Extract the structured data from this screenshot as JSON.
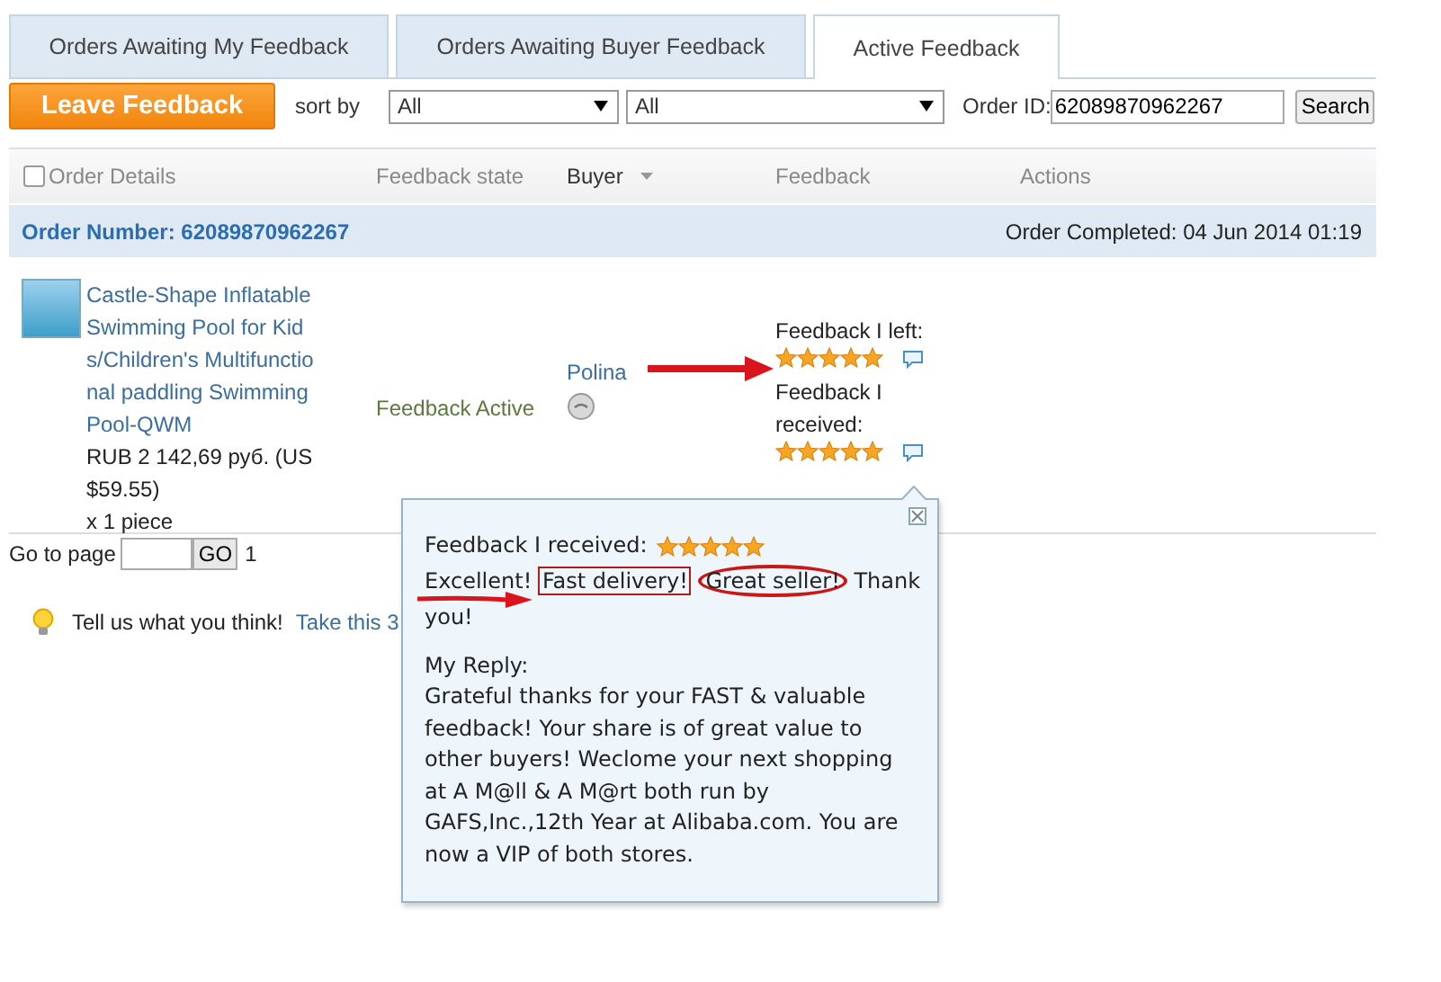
{
  "tabs": [
    {
      "label": "Orders Awaiting My Feedback",
      "selected": false
    },
    {
      "label": "Orders Awaiting Buyer Feedback",
      "selected": false
    },
    {
      "label": "Active Feedback",
      "selected": true
    }
  ],
  "toolbar": {
    "leave_button": "Leave Feedback",
    "sort_label": "sort by",
    "sort_selects": [
      {
        "value": "All"
      },
      {
        "value": "All"
      }
    ],
    "order_id_label": "Order ID:",
    "order_id_value": "62089870962267",
    "search_button": "Search"
  },
  "table": {
    "select_all": {
      "label": "Order Details",
      "checked": false
    },
    "columns": [
      "Feedback state",
      "Buyer",
      "Feedback",
      "Actions"
    ],
    "order": {
      "number": "Order Number: 62089870962267",
      "completed": "Order Completed: 04 Jun 2014 01:19",
      "product_title": "Castle-Shape Inflatable Swimming Pool for Kids/Children's Multifunctional paddling Swimming Pool-QWM",
      "price": "RUB 2 142,69 руб. (US $59.55)",
      "quantity": "x 1 piece",
      "feedback_state": "Feedback Active",
      "buyer": "Polina",
      "feedback": [
        {
          "label": "Feedback I left:",
          "stars": 5
        },
        {
          "label": "Feedback I received:",
          "stars": 5
        }
      ]
    }
  },
  "pager": {
    "label": "Go to page",
    "go_button": "GO",
    "current": "1"
  },
  "tip": {
    "text": "Tell us what you think!",
    "link": "Take this 3"
  },
  "popup": {
    "heading": "Feedback I received:",
    "stars": 5,
    "review": [
      {
        "text": "Excellent!",
        "boxed": false,
        "circled": false
      },
      {
        "text": "Fast delivery!",
        "boxed": true,
        "circled": false
      },
      {
        "text": "Great seller!",
        "boxed": false,
        "circled": true
      },
      {
        "text": "Thank you!",
        "boxed": false,
        "circled": false
      }
    ],
    "reply_label": "My Reply:",
    "reply": "Grateful thanks for your FAST & valuable feedback! Your share is of great value to other buyers! Weclome your next shopping at A M@ll & A M@rt both run by GAFS,Inc.,12th Year at Alibaba.com. You are now a VIP of both stores."
  }
}
